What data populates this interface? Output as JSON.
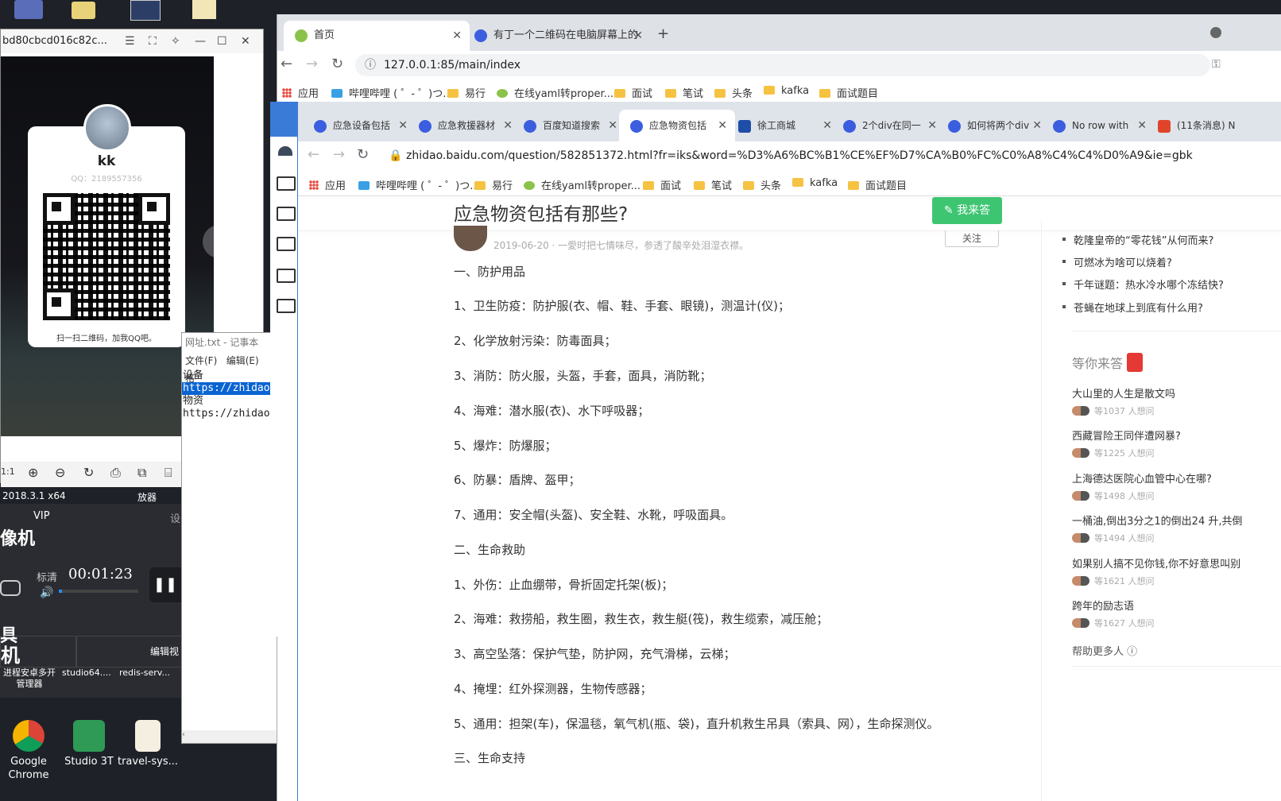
{
  "desktop": {
    "icons": [
      {
        "label": "Google\nChrome",
        "name": "google-chrome-icon"
      },
      {
        "label": "Studio 3T",
        "name": "studio3t-icon"
      },
      {
        "label": "travel-sys...",
        "name": "file-icon"
      }
    ],
    "row_labels": [
      "进程安卓多开管理器",
      "studio64....",
      "redis-serv..."
    ]
  },
  "image_viewer": {
    "title": "bd80cbcd016c82c...",
    "profile_name": "kk",
    "qq": "QQ：2189557356",
    "caption": "扫一扫二维码，加我QQ吧。",
    "bottom_left": "2018.3.1 x64",
    "bottom_right": "放器"
  },
  "player": {
    "vip": "VIP",
    "set": "设",
    "title": "像机",
    "quality": "标清",
    "time": "00:01:23",
    "edit": "编辑视",
    "big1": "具",
    "big2": "机"
  },
  "notepad": {
    "title": "网址.txt - 记事本",
    "menu_file": "文件(F)",
    "menu_edit": "编辑(E)",
    "menu_more": "格",
    "lines": [
      "设备",
      "https://zhidao.",
      "物资",
      "https://zhidao."
    ]
  },
  "outer_browser": {
    "tabs": [
      {
        "label": "首页",
        "active": true
      },
      {
        "label": "有丁一个二维码在电脑屏幕上的",
        "active": false
      }
    ],
    "url": "127.0.0.1:85/main/index",
    "bookmarks": [
      "应用",
      "哔哩哔哩 ( ゜- ゜)つ...",
      "易行",
      "在线yaml转proper...",
      "面试",
      "笔试",
      "头条",
      "kafka",
      "面试题目"
    ]
  },
  "inner_browser": {
    "tabs": [
      {
        "label": "应急设备包括"
      },
      {
        "label": "应急救援器材"
      },
      {
        "label": "百度知道搜索"
      },
      {
        "label": "应急物资包括",
        "active": true
      },
      {
        "label": "徐工商城"
      },
      {
        "label": "2个div在同一"
      },
      {
        "label": "如何将两个div"
      },
      {
        "label": "No row with"
      },
      {
        "label": "(11条消息) N"
      }
    ],
    "url": "zhidao.baidu.com/question/582851372.html?fr=iks&word=%D3%A6%BC%B1%CE%EF%D7%CA%B0%FC%C0%A8%C4%C4%D0%A9&ie=gbk",
    "bookmarks": [
      "应用",
      "哔哩哔哩 ( ゜- ゜)つ...",
      "易行",
      "在线yaml转proper...",
      "面试",
      "笔试",
      "头条",
      "kafka",
      "面试题目"
    ]
  },
  "page": {
    "question_title": "应急物资包括有那些?",
    "answer_button": "我来答",
    "follow_button": "关注",
    "meta": "2019-06-20 · 一愛时把七情味尽，参透了酸辛处泪湿衣襟。",
    "paragraphs": [
      "一、防护用品",
      "1、卫生防疫：防护服(衣、帽、鞋、手套、眼镜)，测温计(仪)；",
      "2、化学放射污染：防毒面具；",
      "3、消防：防火服，头盔，手套，面具，消防靴；",
      "4、海难：潜水服(衣)、水下呼吸器；",
      "5、爆炸：防爆服；",
      "6、防暴：盾牌、盔甲；",
      "7、通用：安全帽(头盔)、安全鞋、水靴，呼吸面具。",
      "二、生命救助",
      "1、外伤：止血绷带，骨折固定托架(板)；",
      "2、海难：救捞船，救生圈，救生衣，救生艇(筏)，救生缆索，减压舱；",
      "3、高空坠落：保护气垫，防护网，充气滑梯，云梯；",
      "4、掩埋：红外探测器，生物传感器；",
      "5、通用：担架(车)，保温毯，氧气机(瓶、袋)，直升机救生吊具（索具、网），生命探测仪。",
      "三、生命支持"
    ],
    "hot_list": [
      "乾隆皇帝的“零花钱”从何而来?",
      "可燃冰为啥可以烧着?",
      "千年谜题：热水冷水哪个冻结快?",
      "苍蝇在地球上到底有什么用?"
    ],
    "waiting_title": "等你来答",
    "waiting": [
      {
        "q": "大山里的人生是散文吗",
        "n": "等1037 人想问"
      },
      {
        "q": "西藏冒险王同伴遭网暴?",
        "n": "等1225 人想问"
      },
      {
        "q": "上海德达医院心血管中心在哪?",
        "n": "等1498 人想问"
      },
      {
        "q": "一桶油,倒出3分之1的倒出24 升,共倒",
        "n": "等1494 人想问"
      },
      {
        "q": "如果别人搞不见你钱,你不好意思叫别",
        "n": "等1621 人想问"
      },
      {
        "q": "跨年的励志语",
        "n": "等1627 人想问"
      }
    ],
    "help_more": "帮助更多人"
  },
  "colors": {
    "answer_green": "#3ec572",
    "selection_blue": "#0a64d2",
    "accent_blue": "#3b7bd8"
  }
}
